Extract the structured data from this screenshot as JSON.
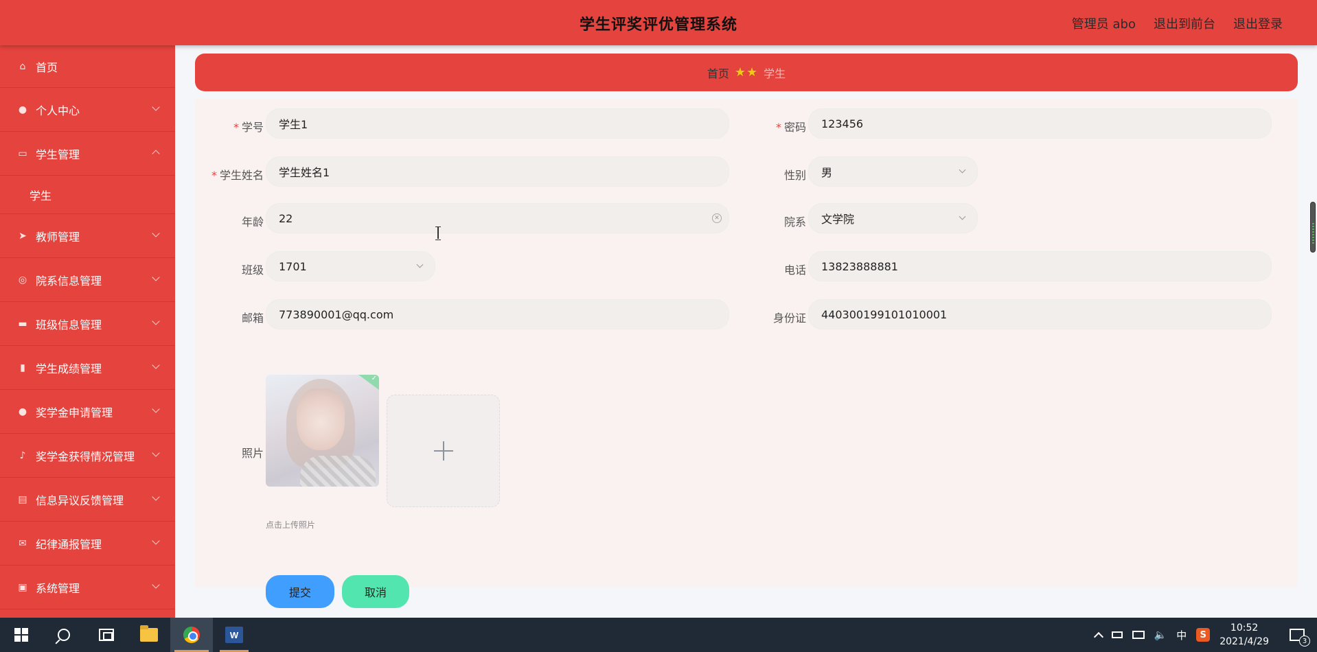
{
  "header": {
    "title": "学生评奖评优管理系统",
    "admin_label": "管理员 abo",
    "back_to_front": "退出到前台",
    "logout": "退出登录"
  },
  "sidebar": {
    "items": [
      {
        "label": "首页",
        "icon": "home-icon"
      },
      {
        "label": "个人中心",
        "icon": "user-icon"
      },
      {
        "label": "学生管理",
        "icon": "chat-icon",
        "expanded": true,
        "sub": [
          "学生"
        ]
      },
      {
        "label": "教师管理",
        "icon": "send-icon"
      },
      {
        "label": "院系信息管理",
        "icon": "basketball-icon"
      },
      {
        "label": "班级信息管理",
        "icon": "monitor-icon"
      },
      {
        "label": "学生成绩管理",
        "icon": "bar-chart-icon"
      },
      {
        "label": "奖学金申请管理",
        "icon": "user-icon"
      },
      {
        "label": "奖学金获得情况管理",
        "icon": "microphone-icon"
      },
      {
        "label": "信息异议反馈管理",
        "icon": "message-icon"
      },
      {
        "label": "纪律通报管理",
        "icon": "mail-icon"
      },
      {
        "label": "系统管理",
        "icon": "window-icon"
      }
    ]
  },
  "breadcrumb": {
    "home": "首页",
    "separator": "★★",
    "current": "学生"
  },
  "form": {
    "student_no": {
      "label": "学号",
      "value": "学生1",
      "required": true
    },
    "password": {
      "label": "密码",
      "value": "123456",
      "required": true
    },
    "student_name": {
      "label": "学生姓名",
      "value": "学生姓名1",
      "required": true
    },
    "gender": {
      "label": "性别",
      "value": "男"
    },
    "age": {
      "label": "年龄",
      "value": "22"
    },
    "department": {
      "label": "院系",
      "value": "文学院"
    },
    "class": {
      "label": "班级",
      "value": "1701"
    },
    "phone": {
      "label": "电话",
      "value": "13823888881"
    },
    "email": {
      "label": "邮箱",
      "value": "773890001@qq.com"
    },
    "id_card": {
      "label": "身份证",
      "value": "440300199101010001"
    },
    "photo": {
      "label": "照片",
      "tip": "点击上传照片"
    },
    "submit": "提交",
    "cancel": "取消"
  },
  "taskbar": {
    "time": "10:52",
    "date": "2021/4/29",
    "ime": "中",
    "sogou": "S",
    "notifications": "3",
    "word_letter": "W"
  },
  "colors": {
    "primary": "#e5433e",
    "submit": "#409eff",
    "cancel": "#52e5b0"
  }
}
